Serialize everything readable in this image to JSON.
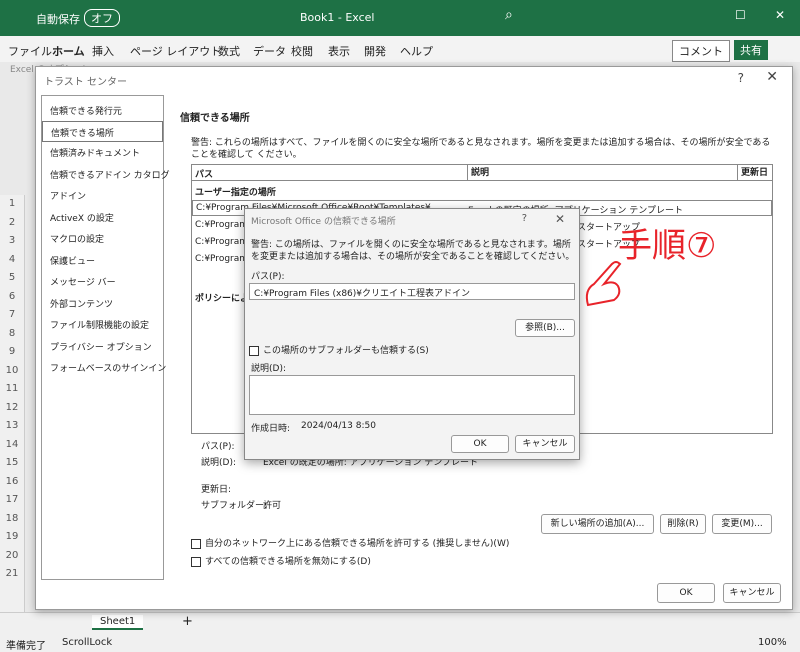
{
  "excel": {
    "autosave_label": "自動保存",
    "autosave_state": "オフ",
    "book_title": "Book1 - Excel",
    "tabs": [
      "ファイル",
      "ホーム",
      "挿入",
      "ページ レイアウト",
      "数式",
      "データ",
      "校閲",
      "表示",
      "開発",
      "ヘルプ"
    ],
    "comment_btn": "コメント",
    "share_btn": "共有",
    "behind_dialog_title": "Excel のオプション",
    "rows": [
      "1",
      "2",
      "3",
      "4",
      "5",
      "6",
      "7",
      "8",
      "9",
      "10",
      "11",
      "12",
      "13",
      "14",
      "15",
      "16",
      "17",
      "18",
      "19",
      "20",
      "21"
    ],
    "sheet_tab": "Sheet1",
    "status_ready": "準備完了",
    "status_scroll": "ScrollLock",
    "zoom": "100%"
  },
  "trust": {
    "title": "トラスト センター",
    "help": "?",
    "close": "✕",
    "sidebar": [
      "信頼できる発行元",
      "信頼できる場所",
      "信頼済みドキュメント",
      "信頼できるアドイン カタログ",
      "アドイン",
      "ActiveX の設定",
      "マクロの設定",
      "保護ビュー",
      "メッセージ バー",
      "外部コンテンツ",
      "ファイル制限機能の設定",
      "プライバシー オプション",
      "フォームベースのサインイン"
    ],
    "heading": "信頼できる場所",
    "warning": "警告: これらの場所はすべて、ファイルを開くのに安全な場所であると見なされます。場所を変更または追加する場合は、その場所が安全であることを確認して ください。",
    "col_path": "パス",
    "col_desc": "説明",
    "col_updated": "更新日",
    "section_user": "ユーザー指定の場所",
    "row1_path": "C:¥Program Files¥Microsoft Office¥Root¥Templates¥",
    "row1_desc": "Excel の既定の場所: アプリケーション テンプレート",
    "row2_path": "C:¥Program",
    "row2_desc": "スタートアップ",
    "row3_path": "C:¥Program",
    "row3_desc": "スタートアップ",
    "row4_path": "C:¥Program",
    "section_policy": "ポリシーによ",
    "detail_path_label": "パス(P):",
    "detail_desc_label": "説明(D):",
    "detail_desc_value": "Excel の既定の場所: アプリケーション テンプレート",
    "detail_updated_label": "更新日:",
    "detail_subfolder_label": "サブフォルダー:",
    "detail_subfolder_value": "許可",
    "add_btn": "新しい場所の追加(A)...",
    "delete_btn": "削除(R)",
    "change_btn": "変更(M)...",
    "chk_network": "自分のネットワーク上にある信頼できる場所を許可する (推奨しません)(W)",
    "chk_disable": "すべての信頼できる場所を無効にする(D)",
    "ok": "OK",
    "cancel": "キャンセル"
  },
  "dialog": {
    "title": "Microsoft Office の信頼できる場所",
    "help": "?",
    "close": "✕",
    "warning": "警告: この場所は、ファイルを開くのに安全な場所であると見なされます。場所を変更または追加する場合は、その場所が安全であることを確認してください。",
    "path_label": "パス(P):",
    "path_value": "C:¥Program Files (x86)¥クリエイト工程表アドイン",
    "browse_btn": "参照(B)...",
    "subfolder_chk": "この場所のサブフォルダーも信頼する(S)",
    "desc_label": "説明(D):",
    "created_label": "作成日時:",
    "created_value": "2024/04/13 8:50",
    "ok": "OK",
    "cancel": "キャンセル"
  },
  "annotation": "手順⑦",
  "colors": {
    "excel_green": "#1e7145",
    "annotation_red": "#e8232a"
  }
}
